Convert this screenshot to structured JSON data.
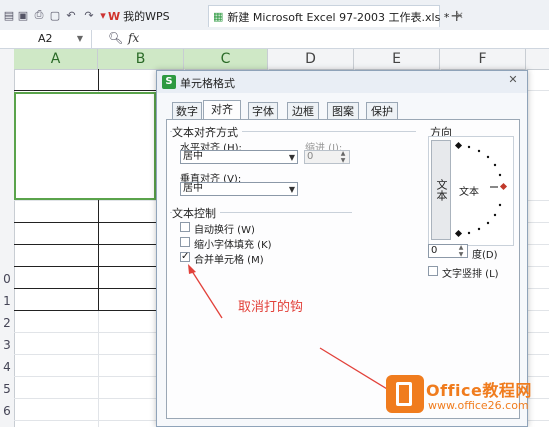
{
  "titlebar": {
    "tabs": [
      {
        "label": "我的WPS"
      },
      {
        "label": "新建 Microsoft Excel 97-2003 工作表.xls *"
      }
    ],
    "new_tab": "+"
  },
  "formula_bar": {
    "cell_ref": "A2",
    "fx_label": "fx"
  },
  "sheet": {
    "columns": [
      "A",
      "B",
      "C",
      "D",
      "E",
      "F"
    ],
    "selected_columns": [
      "A",
      "B",
      "C"
    ],
    "row_numbers": [
      "0",
      "1",
      "2",
      "3",
      "4",
      "5",
      "6"
    ]
  },
  "dialog": {
    "title": "单元格格式",
    "close": "✕",
    "tabs": [
      "数字",
      "对齐",
      "字体",
      "边框",
      "图案",
      "保护"
    ],
    "active_tab": "对齐",
    "alignment_group": "文本对齐方式",
    "horizontal_label": "水平对齐 (H):",
    "horizontal_value": "居中",
    "indent_label": "缩进 (I):",
    "indent_value": "0",
    "vertical_label": "垂直对齐 (V):",
    "vertical_value": "居中",
    "text_control_group": "文本控制",
    "options": [
      {
        "label": "自动换行 (W)",
        "checked": false
      },
      {
        "label": "缩小字体填充 (K)",
        "checked": false
      },
      {
        "label": "合并单元格 (M)",
        "checked": true
      }
    ],
    "orientation_group": "方向",
    "vertical_text_button": "文本",
    "orientation_text": "文本",
    "degree_value": "0",
    "degree_label": "度(D)",
    "vertical_text_checkbox": {
      "label": "文字竖排 (L)",
      "checked": false
    }
  },
  "annotation": "取消打的钩",
  "watermark": {
    "name": "Office教程网",
    "url": "www.office26.com"
  },
  "colors": {
    "selection_green": "#5aa34b",
    "annotation_red": "#e2413a",
    "watermark_orange": "#f07c1e"
  }
}
